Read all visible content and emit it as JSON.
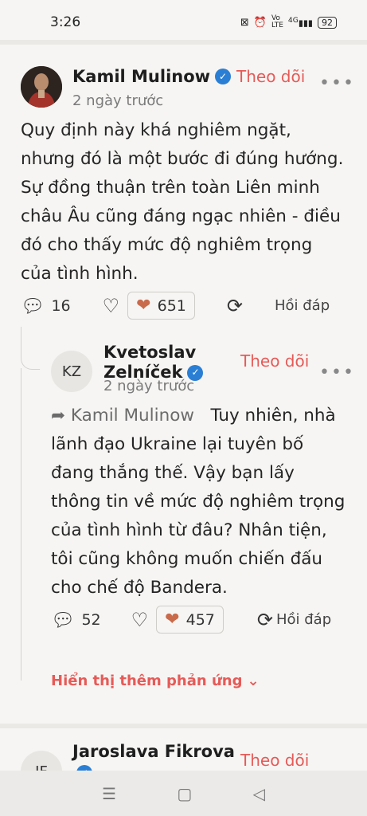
{
  "status": {
    "time": "3:26",
    "icons": [
      "nfc-icon",
      "alarm-icon",
      "volte-icon",
      "4g-signal-icon"
    ],
    "signal_label": "4G",
    "battery": "92"
  },
  "post": {
    "author": "Kamil Mulinow",
    "follow": "Theo dõi",
    "time": "2 ngày trước",
    "text": "Quy định này khá nghiêm ngặt, nhưng đó là một bước đi đúng hướng. Sự đồng thuận trên toàn Liên minh châu Âu cũng đáng ngạc nhiên - điều đó cho thấy mức độ nghiêm trọng của tình hình.",
    "comments": "16",
    "hearts": "651",
    "reply": "Hồi đáp"
  },
  "reply": {
    "initials": "KZ",
    "author_line1": "Kvetoslav",
    "author_line2": "Zelníček",
    "follow": "Theo dõi",
    "time": "2 ngày trước",
    "quoted": "Kamil Mulinow",
    "text": "Tuy nhiên, nhà lãnh đạo Ukraine lại tuyên bố đang thắng thế. Vậy bạn lấy thông tin về mức độ nghiêm trọng của tình hình từ đâu? Nhân tiện, tôi cũng không muốn chiến đấu cho chế độ Bandera.",
    "comments": "52",
    "hearts": "457",
    "reply": "Hồi đáp"
  },
  "show_more": "Hiển thị thêm phản ứng",
  "next_post": {
    "initials": "JF",
    "author": "Jaroslava Fikrova",
    "follow": "Theo dõi"
  },
  "colors": {
    "accent": "#e65a57",
    "verified": "#2a7fd4",
    "heart": "#c96a4a"
  }
}
